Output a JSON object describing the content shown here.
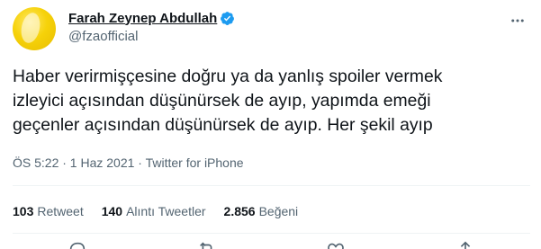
{
  "tweet": {
    "author": {
      "display_name": "Farah Zeynep Abdullah",
      "handle": "@fzaofficial",
      "verified": true
    },
    "text": "Haber verirmişçesine doğru ya da yanlış spoiler vermek\nizleyici açısından düşünürsek de ayıp, yapımda emeği\ngeçenler açısından düşünürsek de ayıp. Her şekil ayıp",
    "meta": "ÖS 5:22 · 1 Haz 2021 · Twitter for iPhone",
    "stats": {
      "retweets": {
        "count": "103",
        "label": "Retweet"
      },
      "quotes": {
        "count": "140",
        "label": "Alıntı Tweetler"
      },
      "likes": {
        "count": "2.856",
        "label": "Beğeni"
      }
    }
  },
  "icons": {
    "more": "more-options-icon",
    "verified": "verified-badge-icon",
    "reply": "reply-icon",
    "retweet": "retweet-icon",
    "like": "heart-icon",
    "share": "share-icon"
  },
  "colors": {
    "text": "#0f1419",
    "secondary": "#536471",
    "verified": "#1d9bf0",
    "divider": "#eff3f4",
    "avatar": "#f6d20a"
  }
}
